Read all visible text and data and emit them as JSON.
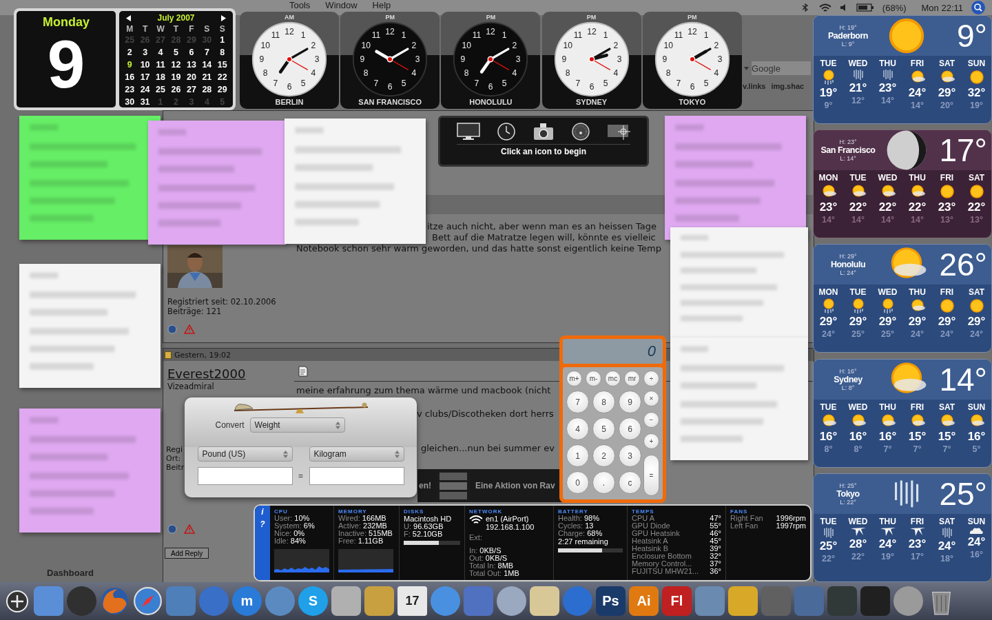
{
  "menu_bar": {
    "items": [
      "Tools",
      "Window",
      "Help"
    ],
    "battery": "(68%)",
    "clock": "Mon 22:11"
  },
  "browser": {
    "search_placeholder": "Google",
    "bookmarks": [
      "v.links",
      "img.shac"
    ]
  },
  "post_1": {
    "lines": [
      "itze auch nicht, aber wenn man es an heissen Tage",
      "Bett auf die Matratze legen will, könnte es vielleic",
      "Notebook schon sehr warm geworden, und das hatte sonst eigentlich keine Temp"
    ],
    "registered": "Registriert seit: 02.10.2006",
    "count": "Beiträge: 121"
  },
  "post_2": {
    "date": "Gestern, 19:02",
    "author": "Everest2000",
    "rank": "Vizeadmiral",
    "lines": [
      "meine erfahrung zum thema wärme und macbook (nicht",
      "v clubs/Discotheken dort herrs",
      "gleichen...nun bei summer ev"
    ],
    "info": [
      "Regi",
      "Ort:",
      "Beitr"
    ],
    "banner": [
      "en!",
      "Eine Aktion von Rav"
    ]
  },
  "add_reply": "Add Reply",
  "dashboard": {
    "label": "Dashboard"
  },
  "notes": [
    {
      "color": "#66ee66"
    },
    {
      "color": "#dfa8f0"
    },
    {
      "color": "#f4f4f4"
    },
    {
      "color": "#dfa8f0"
    },
    {
      "color": "#f4f4f4"
    },
    {
      "color": "#dfa8f0"
    },
    {
      "color": "#f4f4f4"
    },
    {
      "color": "#f4f4f4"
    }
  ],
  "calendar": {
    "weekday": "Monday",
    "day": "9",
    "month": "July 2007",
    "weekdays": [
      "M",
      "T",
      "W",
      "T",
      "F",
      "S",
      "S"
    ],
    "weeks": [
      [
        {
          "d": "25",
          "in_month": false,
          "selected": false
        },
        {
          "d": "26",
          "in_month": false,
          "selected": false
        },
        {
          "d": "27",
          "in_month": false,
          "selected": false
        },
        {
          "d": "28",
          "in_month": false,
          "selected": false
        },
        {
          "d": "29",
          "in_month": false,
          "selected": false
        },
        {
          "d": "30",
          "in_month": false,
          "selected": false
        },
        {
          "d": "1",
          "in_month": true,
          "selected": false
        }
      ],
      [
        {
          "d": "2",
          "in_month": true,
          "selected": false
        },
        {
          "d": "3",
          "in_month": true,
          "selected": false
        },
        {
          "d": "4",
          "in_month": true,
          "selected": false
        },
        {
          "d": "5",
          "in_month": true,
          "selected": false
        },
        {
          "d": "6",
          "in_month": true,
          "selected": false
        },
        {
          "d": "7",
          "in_month": true,
          "selected": false
        },
        {
          "d": "8",
          "in_month": true,
          "selected": false
        }
      ],
      [
        {
          "d": "9",
          "in_month": true,
          "selected": true
        },
        {
          "d": "10",
          "in_month": true,
          "selected": false
        },
        {
          "d": "11",
          "in_month": true,
          "selected": false
        },
        {
          "d": "12",
          "in_month": true,
          "selected": false
        },
        {
          "d": "13",
          "in_month": true,
          "selected": false
        },
        {
          "d": "14",
          "in_month": true,
          "selected": false
        },
        {
          "d": "15",
          "in_month": true,
          "selected": false
        }
      ],
      [
        {
          "d": "16",
          "in_month": true,
          "selected": false
        },
        {
          "d": "17",
          "in_month": true,
          "selected": false
        },
        {
          "d": "18",
          "in_month": true,
          "selected": false
        },
        {
          "d": "19",
          "in_month": true,
          "selected": false
        },
        {
          "d": "20",
          "in_month": true,
          "selected": false
        },
        {
          "d": "21",
          "in_month": true,
          "selected": false
        },
        {
          "d": "22",
          "in_month": true,
          "selected": false
        }
      ],
      [
        {
          "d": "23",
          "in_month": true,
          "selected": false
        },
        {
          "d": "24",
          "in_month": true,
          "selected": false
        },
        {
          "d": "25",
          "in_month": true,
          "selected": false
        },
        {
          "d": "26",
          "in_month": true,
          "selected": false
        },
        {
          "d": "27",
          "in_month": true,
          "selected": false
        },
        {
          "d": "28",
          "in_month": true,
          "selected": false
        },
        {
          "d": "29",
          "in_month": true,
          "selected": false
        }
      ],
      [
        {
          "d": "30",
          "in_month": true,
          "selected": false
        },
        {
          "d": "31",
          "in_month": true,
          "selected": false
        },
        {
          "d": "1",
          "in_month": false,
          "selected": false
        },
        {
          "d": "2",
          "in_month": false,
          "selected": false
        },
        {
          "d": "3",
          "in_month": false,
          "selected": false
        },
        {
          "d": "4",
          "in_month": false,
          "selected": false
        },
        {
          "d": "5",
          "in_month": false,
          "selected": false
        }
      ]
    ]
  },
  "clocks": [
    {
      "city": "BERLIN",
      "period": "AM",
      "kind": "light",
      "numerals": [
        "11",
        "12",
        "1",
        "10",
        "2",
        "9",
        "3",
        "8",
        "4",
        "7",
        "6",
        "5"
      ]
    },
    {
      "city": "SAN FRANCISCO",
      "period": "PM",
      "kind": "dark",
      "numerals": [
        "11",
        "12",
        "1",
        "10",
        "2",
        "9",
        "3",
        "8",
        "4",
        "7",
        "6",
        "5"
      ]
    },
    {
      "city": "HONOLULU",
      "period": "PM",
      "kind": "dark",
      "numerals": [
        "11",
        "12",
        "1",
        "10",
        "2",
        "9",
        "3",
        "8",
        "4",
        "7",
        "6",
        "5"
      ]
    },
    {
      "city": "SYDNEY",
      "period": "PM",
      "kind": "light",
      "numerals": [
        "11",
        "12",
        "1",
        "10",
        "2",
        "9",
        "3",
        "8",
        "4",
        "7",
        "6",
        "5"
      ]
    },
    {
      "city": "TOKYO",
      "period": "PM",
      "kind": "light",
      "numerals": [
        "11",
        "12",
        "1",
        "10",
        "2",
        "9",
        "3",
        "8",
        "4",
        "7",
        "6",
        "5"
      ]
    }
  ],
  "weather": [
    {
      "city": "Paderborn",
      "high": "H: 19°",
      "low": "L: 9°",
      "temp": "9°",
      "kind": "sun",
      "night": false,
      "days": [
        {
          "day": "TUE",
          "kind": "showers",
          "high": "19°",
          "low": "9°"
        },
        {
          "day": "WED",
          "kind": "rain",
          "high": "21°",
          "low": "12°"
        },
        {
          "day": "THU",
          "kind": "rain",
          "high": "23°",
          "low": "14°"
        },
        {
          "day": "FRI",
          "kind": "partly",
          "high": "24°",
          "low": "14°"
        },
        {
          "day": "SAT",
          "kind": "partly",
          "high": "29°",
          "low": "20°"
        },
        {
          "day": "SUN",
          "kind": "sun",
          "high": "32°",
          "low": "19°"
        }
      ]
    },
    {
      "city": "San Francisco",
      "high": "H: 23°",
      "low": "L: 14°",
      "temp": "17°",
      "kind": "moon",
      "night": true,
      "days": [
        {
          "day": "MON",
          "kind": "partly",
          "high": "23°",
          "low": "14°"
        },
        {
          "day": "TUE",
          "kind": "partly",
          "high": "22°",
          "low": "14°"
        },
        {
          "day": "WED",
          "kind": "partly",
          "high": "22°",
          "low": "14°"
        },
        {
          "day": "THU",
          "kind": "partly",
          "high": "22°",
          "low": "14°"
        },
        {
          "day": "FRI",
          "kind": "sun",
          "high": "23°",
          "low": "13°"
        },
        {
          "day": "SAT",
          "kind": "sun",
          "high": "22°",
          "low": "13°"
        }
      ]
    },
    {
      "city": "Honolulu",
      "high": "H: 29°",
      "low": "L: 24°",
      "temp": "26°",
      "kind": "partly",
      "night": false,
      "days": [
        {
          "day": "MON",
          "kind": "showers",
          "high": "29°",
          "low": "24°"
        },
        {
          "day": "TUE",
          "kind": "showers",
          "high": "29°",
          "low": "25°"
        },
        {
          "day": "WED",
          "kind": "showers",
          "high": "29°",
          "low": "25°"
        },
        {
          "day": "THU",
          "kind": "partly",
          "high": "29°",
          "low": "24°"
        },
        {
          "day": "FRI",
          "kind": "sun",
          "high": "29°",
          "low": "24°"
        },
        {
          "day": "SAT",
          "kind": "sun",
          "high": "29°",
          "low": "24°"
        }
      ]
    },
    {
      "city": "Sydney",
      "high": "H: 16°",
      "low": "L: 8°",
      "temp": "14°",
      "kind": "partly",
      "night": false,
      "days": [
        {
          "day": "TUE",
          "kind": "partly",
          "high": "16°",
          "low": "8°"
        },
        {
          "day": "WED",
          "kind": "partly",
          "high": "16°",
          "low": "8°"
        },
        {
          "day": "THU",
          "kind": "partly",
          "high": "16°",
          "low": "7°"
        },
        {
          "day": "FRI",
          "kind": "partly",
          "high": "15°",
          "low": "7°"
        },
        {
          "day": "SAT",
          "kind": "partly",
          "high": "15°",
          "low": "7°"
        },
        {
          "day": "SUN",
          "kind": "partly",
          "high": "16°",
          "low": "5°"
        }
      ]
    },
    {
      "city": "Tokyo",
      "high": "H: 25°",
      "low": "L: 22°",
      "temp": "25°",
      "kind": "rain",
      "night": false,
      "days": [
        {
          "day": "TUE",
          "kind": "rain",
          "high": "25°",
          "low": "22°"
        },
        {
          "day": "WED",
          "kind": "storm",
          "high": "28°",
          "low": "22°"
        },
        {
          "day": "THU",
          "kind": "storm",
          "high": "24°",
          "low": "19°"
        },
        {
          "day": "FRI",
          "kind": "storm",
          "high": "23°",
          "low": "17°"
        },
        {
          "day": "SAT",
          "kind": "rain",
          "high": "24°",
          "low": "18°"
        },
        {
          "day": "SUN",
          "kind": "cloudy",
          "high": "24°",
          "low": "16°"
        }
      ]
    }
  ],
  "capture_widget": {
    "hint": "Click an icon to begin"
  },
  "converter": {
    "title": "Convert",
    "type": "Weight",
    "from": "Pound (US)",
    "to": "Kilogram",
    "equals": "="
  },
  "calculator": {
    "display": "0",
    "memory": [
      "m+",
      "m-",
      "mc",
      "mr"
    ],
    "digits": [
      "7",
      "8",
      "9",
      "4",
      "5",
      "6",
      "1",
      "2",
      "3",
      "0",
      ".",
      "c"
    ],
    "operators": [
      "÷",
      "×",
      "−",
      "+",
      "="
    ]
  },
  "system_monitor": {
    "info": "i",
    "help": "?",
    "sections": [
      {
        "kind": "cpu",
        "title": "CPU",
        "rows": [
          {
            "label": "User:",
            "value": "10%"
          },
          {
            "label": "System:",
            "value": "6%"
          },
          {
            "label": "Nice:",
            "value": "0%"
          },
          {
            "label": "Idle:",
            "value": "84%"
          }
        ]
      },
      {
        "kind": "memory",
        "title": "MEMORY",
        "rows": [
          {
            "label": "Wired:",
            "value": "166MB"
          },
          {
            "label": "Active:",
            "value": "232MB"
          },
          {
            "label": "Inactive:",
            "value": "515MB"
          },
          {
            "label": "Free:",
            "value": "1.11GB"
          }
        ]
      },
      {
        "kind": "disk",
        "title": "DISKS",
        "name": "Macintosh HD",
        "rows": [
          {
            "label": "U:",
            "value": "96.63GB"
          },
          {
            "label": "F:",
            "value": "52.10GB"
          }
        ],
        "level": 0.62
      },
      {
        "kind": "network",
        "title": "NETWORK",
        "interface": "en1 (AirPort)",
        "ip": "192.168.1.100",
        "ext": "Ext:",
        "rows": [
          {
            "label": "In:",
            "value": "0KB/S"
          },
          {
            "label": "Out:",
            "value": "0KB/S"
          },
          {
            "label": "Total In:",
            "value": "8MB"
          },
          {
            "label": "Total Out:",
            "value": "1MB"
          }
        ]
      },
      {
        "kind": "battery",
        "title": "BATTERY",
        "rows": [
          {
            "label": "Health:",
            "value": "98%"
          },
          {
            "label": "Cycles:",
            "value": "13"
          },
          {
            "label": "Charge:",
            "value": "68%"
          }
        ],
        "remaining": "2:27 remaining",
        "level": 0.68
      },
      {
        "kind": "temps",
        "title": "TEMPS",
        "rows": [
          {
            "label": "CPU A",
            "value": "47°"
          },
          {
            "label": "GPU Diode",
            "value": "55°"
          },
          {
            "label": "GPU Heatsink",
            "value": "46°"
          },
          {
            "label": "Heatsink A",
            "value": "45°"
          },
          {
            "label": "Heatsink B",
            "value": "39°"
          },
          {
            "label": "Enclosure Bottom",
            "value": "32°"
          },
          {
            "label": "Memory Control...",
            "value": "37°"
          },
          {
            "label": "FUJITSU MHW21...",
            "value": "36°"
          }
        ]
      },
      {
        "kind": "fans",
        "title": "FANS",
        "rows": [
          {
            "label": "Right Fan",
            "value": "1996rpm"
          },
          {
            "label": "Left Fan",
            "value": "1997rpm"
          }
        ]
      }
    ]
  },
  "dock": [
    {
      "kind": "tile",
      "color": "#5a8fd8"
    },
    {
      "kind": "disc",
      "color": "#303030"
    },
    {
      "kind": "globe",
      "color": "#e2701c"
    },
    {
      "kind": "compass",
      "color": "#3b7fd0"
    },
    {
      "kind": "tile",
      "color": "#4e7fb8"
    },
    {
      "kind": "disc",
      "color": "#3a6fc8"
    },
    {
      "kind": "disc",
      "color": "#2a7ad8",
      "label": "m"
    },
    {
      "kind": "disc",
      "color": "#5a8ac0"
    },
    {
      "kind": "disc",
      "color": "#1fa0e8",
      "label": "S"
    },
    {
      "kind": "tile",
      "color": "#b0b0b0"
    },
    {
      "kind": "tile",
      "color": "#c8a040"
    },
    {
      "kind": "calendar",
      "color": "#e8e8e8",
      "label": "17"
    },
    {
      "kind": "disc",
      "color": "#4a90e0"
    },
    {
      "kind": "tile",
      "color": "#5070c0"
    },
    {
      "kind": "disc",
      "color": "#9aa8c0"
    },
    {
      "kind": "tile",
      "color": "#d8c898"
    },
    {
      "kind": "disc",
      "color": "#2c6ed0"
    },
    {
      "kind": "tile",
      "color": "#1a3a6a",
      "label": "Ps"
    },
    {
      "kind": "tile",
      "color": "#e07a10",
      "label": "Ai"
    },
    {
      "kind": "tile",
      "color": "#c02020",
      "label": "Fl"
    },
    {
      "kind": "tile",
      "color": "#6a8ab0"
    },
    {
      "kind": "tile",
      "color": "#d8a828"
    },
    {
      "kind": "tile",
      "color": "#606060"
    },
    {
      "kind": "tile",
      "color": "#4a6a9a"
    },
    {
      "kind": "tile",
      "color": "#303838"
    },
    {
      "kind": "tile",
      "color": "#202020"
    },
    {
      "kind": "disc",
      "color": "#9a9a9a"
    },
    {
      "kind": "trash",
      "color": "#8a8a8a"
    }
  ]
}
